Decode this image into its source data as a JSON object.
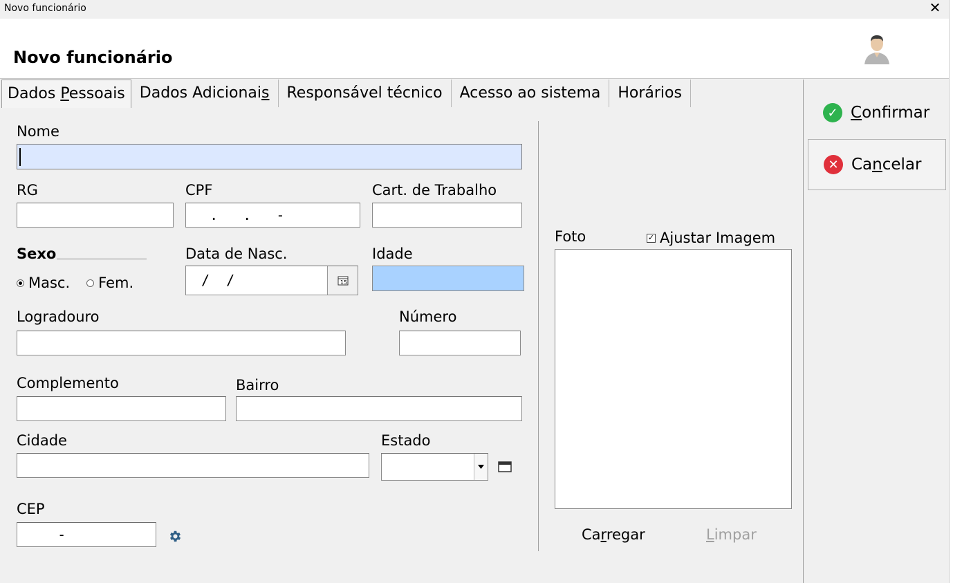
{
  "window": {
    "title": "Novo funcionário",
    "close_glyph": "✕"
  },
  "header": {
    "title": "Novo funcionário",
    "avatar_icon": "user-avatar-icon"
  },
  "tabs": [
    {
      "pre": "Dados ",
      "u": "P",
      "post": "essoais",
      "active": true
    },
    {
      "pre": "Dados Adicionai",
      "u": "s",
      "post": "",
      "active": false
    },
    {
      "pre": "Responsável técnico",
      "u": "",
      "post": "",
      "active": false
    },
    {
      "pre": "Acesso ao sistema",
      "u": "",
      "post": "",
      "active": false
    },
    {
      "pre": "Horários",
      "u": "",
      "post": "",
      "active": false
    }
  ],
  "form": {
    "nome_label": "Nome",
    "rg_label": "RG",
    "cpf_label": "CPF",
    "cpf_mask": "  .   .   -",
    "cart_label": "Cart. de Trabalho",
    "sexo_label": "Sexo",
    "masc_label": "Masc.",
    "fem_label": "Fem.",
    "nasc_label": "Data de Nasc.",
    "nasc_mask": " /  /",
    "idade_label": "Idade",
    "logradouro_label": "Logradouro",
    "numero_label": "Número",
    "complemento_label": "Complemento",
    "bairro_label": "Bairro",
    "cidade_label": "Cidade",
    "estado_label": "Estado",
    "cep_label": "CEP",
    "cep_mask": "    -"
  },
  "photo": {
    "label": "Foto",
    "ajustar_label": "Ajustar Imagem",
    "ajustar_checked": true,
    "carregar": {
      "pre": "Ca",
      "u": "r",
      "post": "regar"
    },
    "limpar": {
      "pre": "",
      "u": "L",
      "post": "impar"
    }
  },
  "actions": {
    "confirmar": {
      "pre": "",
      "u": "C",
      "post": "onfirmar"
    },
    "cancelar": {
      "pre": "Ca",
      "u": "n",
      "post": "celar"
    }
  },
  "colors": {
    "confirm": "#2eb34e",
    "cancel": "#e0303b",
    "focus_field": "#dce8ff",
    "readonly_field": "#a9d2ff"
  }
}
